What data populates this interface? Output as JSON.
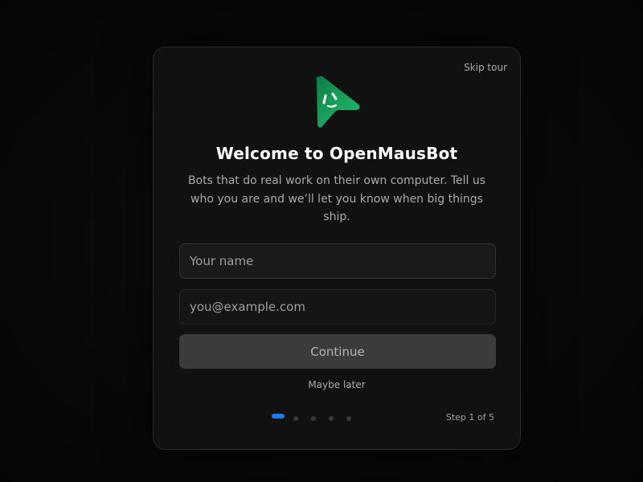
{
  "onboarding": {
    "skip_label": "Skip tour",
    "title": "Welcome to OpenMausBot",
    "subtitle": "Bots that do real work on their own computer. Tell us who you are and we’ll let you know when big things ship.",
    "name_placeholder": "Your name",
    "name_value": "",
    "email_placeholder": "you@example.com",
    "email_value": "",
    "continue_label": "Continue",
    "later_label": "Maybe later",
    "step_label": "Step 1 of 5",
    "current_step": 1,
    "total_steps": 5,
    "logo_icon": "cursor-smile-logo-icon"
  },
  "colors": {
    "background": "#060606",
    "card": "#111111",
    "accent": "#1a7ff0",
    "logo_green": "#1aa05c",
    "button_disabled": "#3b3b3b"
  }
}
